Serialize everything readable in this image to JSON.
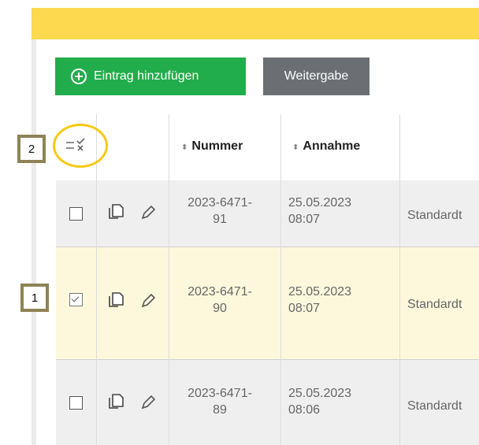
{
  "toolbar": {
    "add_label": "Eintrag hinzufügen",
    "share_label": "Weitergabe"
  },
  "table": {
    "headers": {
      "number": "Nummer",
      "acceptance": "Annahme",
      "sort_glyph": "⬍"
    },
    "rows": [
      {
        "number_line1": "2023-6471-",
        "number_line2": "91",
        "date": "25.05.2023",
        "time": "08:07",
        "type": "Standardt",
        "checked": false
      },
      {
        "number_line1": "2023-6471-",
        "number_line2": "90",
        "date": "25.05.2023",
        "time": "08:07",
        "type": "Standardt",
        "checked": true
      },
      {
        "number_line1": "2023-6471-",
        "number_line2": "89",
        "date": "25.05.2023",
        "time": "08:06",
        "type": "Standardt",
        "checked": false
      }
    ]
  },
  "annotations": {
    "marker_1": "1",
    "marker_2": "2"
  },
  "colors": {
    "top_bar": "#fcd94e",
    "add_button": "#21ad4b",
    "share_button": "#6b6f73",
    "selected_row": "#fdf8dc",
    "highlight": "#f7c913",
    "marker_border": "#8d8355"
  },
  "icons": {
    "bulk_select": "check-cross-list-icon",
    "copy": "copy-icon",
    "edit": "pencil-icon",
    "add": "plus-circle-icon"
  }
}
